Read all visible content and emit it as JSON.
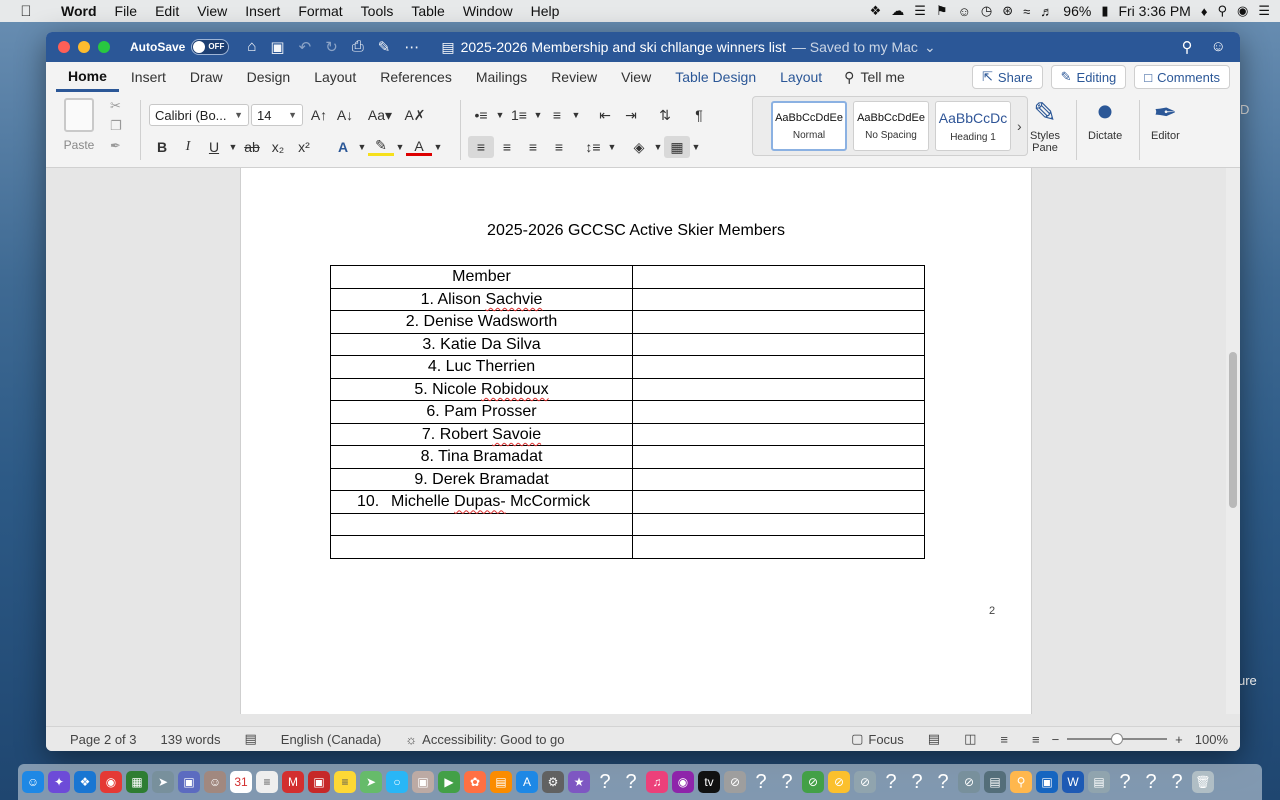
{
  "menubar": {
    "app": "Word",
    "items": [
      "File",
      "Edit",
      "View",
      "Insert",
      "Format",
      "Tools",
      "Table",
      "Window",
      "Help"
    ],
    "battery": "96%",
    "clock": "Fri 3:36 PM"
  },
  "titlebar": {
    "autosave_label": "AutoSave",
    "autosave_state": "OFF",
    "doc_name": "2025-2026 Membership and ski chllange winners list",
    "saved_status": "— Saved to my Mac"
  },
  "tabs": {
    "items": [
      "Home",
      "Insert",
      "Draw",
      "Design",
      "Layout",
      "References",
      "Mailings",
      "Review",
      "View",
      "Table Design",
      "Layout"
    ],
    "tell_me": "Tell me",
    "share": "Share",
    "editing": "Editing",
    "comments": "Comments"
  },
  "ribbon": {
    "paste_label": "Paste",
    "font_name": "Calibri (Bo...",
    "font_size": "14",
    "styles": [
      {
        "preview": "AaBbCcDdEe",
        "name": "Normal"
      },
      {
        "preview": "AaBbCcDdEe",
        "name": "No Spacing"
      },
      {
        "preview": "AaBbCcDc",
        "name": "Heading 1"
      }
    ],
    "styles_pane_line1": "Styles",
    "styles_pane_line2": "Pane",
    "dictate": "Dictate",
    "editor": "Editor"
  },
  "document": {
    "title": "2025-2026 GCCSC Active Skier Members",
    "header_col1": "Member",
    "header_col2": "",
    "members": [
      "1. Alison Sachvie",
      "2. Denise Wadsworth",
      "3. Katie Da Silva",
      "4. Luc Therrien",
      "5. Nicole Robidoux",
      "6. Pam Prosser",
      "7. Robert Savoie",
      "8. Tina Bramadat",
      "9. Derek Bramadat"
    ],
    "member10_num": "10.",
    "member10_name": "Michelle Dupas- McCormick",
    "page_number": "2"
  },
  "statusbar": {
    "page": "Page 2 of 3",
    "words": "139 words",
    "language": "English (Canada)",
    "accessibility": "Accessibility: Good to go",
    "focus": "Focus",
    "zoom": "100%",
    "zoom_fraction": 0.5
  },
  "desktop": {
    "fragment_top": "D",
    "fragment_bottom": "ure"
  }
}
